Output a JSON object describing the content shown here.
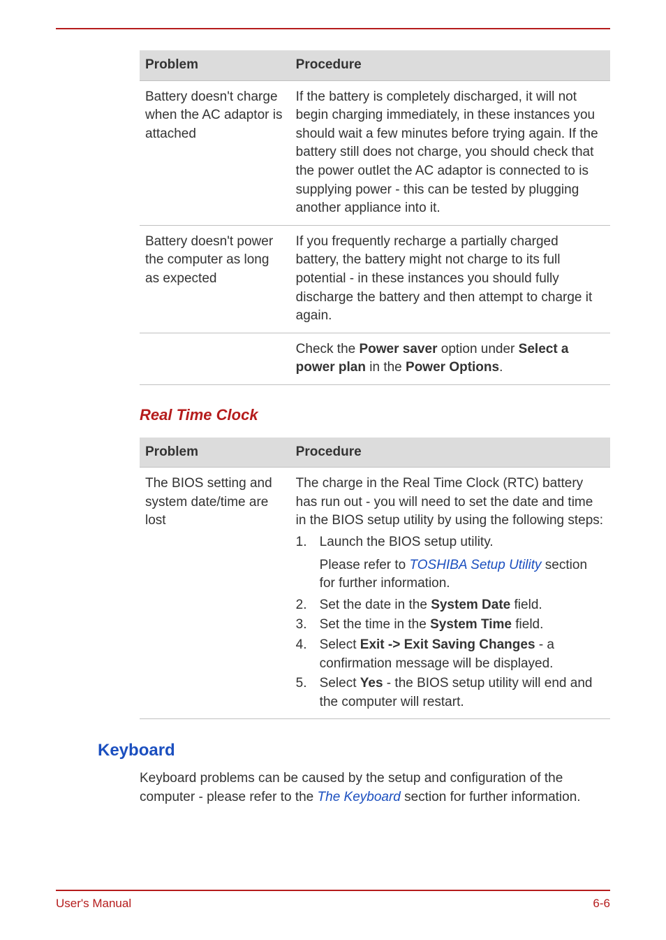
{
  "table1": {
    "headers": {
      "problem": "Problem",
      "procedure": "Procedure"
    },
    "rows": [
      {
        "problem": "Battery doesn't charge when the AC adaptor is attached",
        "procedure": "If the battery is completely discharged, it will not begin charging immediately, in these instances you should wait a few minutes before trying again. If the battery still does not charge, you should check that the power outlet the AC adaptor is connected to is supplying power - this can be tested by plugging another appliance into it."
      },
      {
        "problem": "Battery doesn't power the computer as long as expected",
        "procedure": "If you frequently recharge a partially charged battery, the battery might not charge to its full potential - in these instances you should fully discharge the battery and then attempt to charge it again."
      }
    ],
    "row3": {
      "pre": "Check the ",
      "ps": "Power saver",
      "mid": " option under ",
      "sel": "Select a power plan",
      "mid2": " in the ",
      "po": "Power Options",
      "end": "."
    }
  },
  "rtc_heading": "Real Time Clock",
  "table2": {
    "headers": {
      "problem": "Problem",
      "procedure": "Procedure"
    },
    "row": {
      "problem": "The BIOS setting and system date/time are lost",
      "intro": "The charge in the Real Time Clock (RTC) battery has run out - you will need to set the date and time in the BIOS setup utility by using the following steps:",
      "step1": "Launch the BIOS setup utility.",
      "note_pre": "Please refer to ",
      "note_link": "TOSHIBA Setup Utility",
      "note_post": " section for further information.",
      "step2_pre": "Set the date in the ",
      "step2_bold": "System Date",
      "step2_post": " field.",
      "step3_pre": "Set the time in the ",
      "step3_bold": "System Time",
      "step3_post": " field.",
      "step4_pre": "Select ",
      "step4_bold": "Exit -> Exit Saving Changes",
      "step4_post": " - a confirmation message will be displayed.",
      "step5_pre": "Select ",
      "step5_bold": "Yes",
      "step5_post": " - the BIOS setup utility will end and the computer will restart."
    }
  },
  "keyboard_heading": "Keyboard",
  "keyboard_body_pre": "Keyboard problems can be caused by the setup and configuration of the computer - please refer to the ",
  "keyboard_link": "The Keyboard",
  "keyboard_body_post": " section for further information.",
  "footer_left": "User's Manual",
  "footer_right": "6-6"
}
